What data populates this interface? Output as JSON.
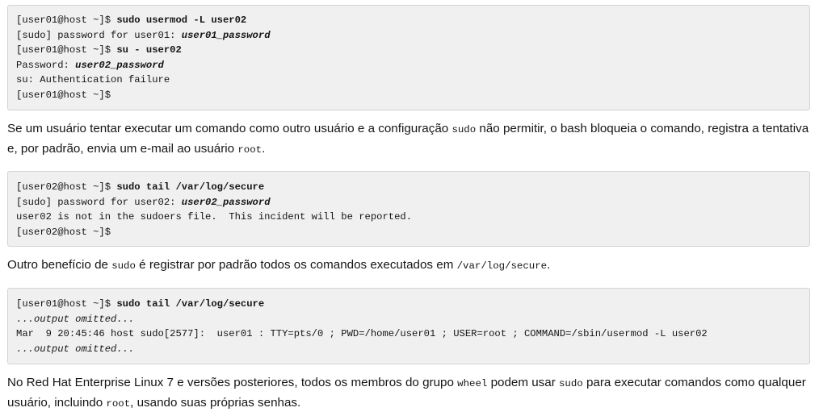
{
  "block1": {
    "l1": {
      "prompt": "[user01@host ~]$ ",
      "cmd": "sudo usermod -L user02"
    },
    "l2": {
      "text": "[sudo] password for user01: ",
      "input": "user01_password"
    },
    "l3": {
      "prompt": "[user01@host ~]$ ",
      "cmd": "su - user02"
    },
    "l4": {
      "text": "Password: ",
      "input": "user02_password"
    },
    "l5": {
      "text": "su: Authentication failure"
    },
    "l6": {
      "prompt": "[user01@host ~]$"
    }
  },
  "para1": {
    "t1": "Se um usuário tentar executar um comando como outro usuário e a configuração ",
    "c1": "sudo",
    "t2": " não permitir, o bash bloqueia o comando, registra a tentativa e, por padrão, envia um e-mail ao usuário ",
    "c2": "root",
    "t3": "."
  },
  "block2": {
    "l1": {
      "prompt": "[user02@host ~]$ ",
      "cmd": "sudo tail /var/log/secure"
    },
    "l2": {
      "text": "[sudo] password for user02: ",
      "input": "user02_password"
    },
    "l3": {
      "text": "user02 is not in the sudoers file.  This incident will be reported."
    },
    "l4": {
      "prompt": "[user02@host ~]$"
    }
  },
  "para2": {
    "t1": "Outro benefício de ",
    "c1": "sudo",
    "t2": " é registrar por padrão todos os comandos executados em ",
    "c2": "/var/log/secure",
    "t3": "."
  },
  "block3": {
    "l1": {
      "prompt": "[user01@host ~]$ ",
      "cmd": "sudo tail /var/log/secure"
    },
    "l2": {
      "omit": "...output omitted..."
    },
    "l3": {
      "text": "Mar  9 20:45:46 host sudo[2577]:  user01 : TTY=pts/0 ; PWD=/home/user01 ; USER=root ; COMMAND=/sbin/usermod -L user02"
    },
    "l4": {
      "omit": "...output omitted..."
    }
  },
  "para3": {
    "t1": "No Red Hat Enterprise Linux 7 e versões posteriores, todos os membros do grupo ",
    "c1": "wheel",
    "t2": " podem usar ",
    "c2": "sudo",
    "t3": " para executar comandos como qualquer usuário, incluindo ",
    "c3": "root",
    "t4": ", usando suas próprias senhas."
  }
}
